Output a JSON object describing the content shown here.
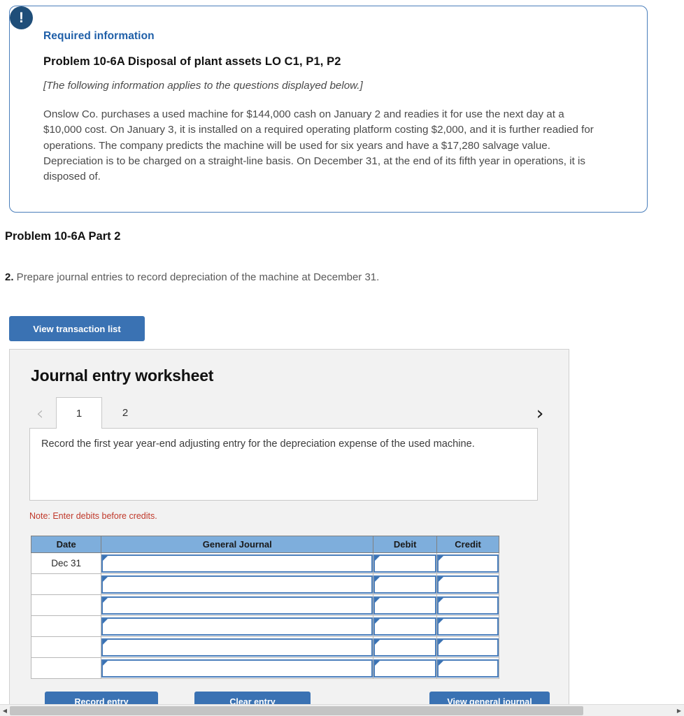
{
  "info_box": {
    "badge_icon": "exclamation-icon",
    "badge_glyph": "!",
    "required_label": "Required information",
    "problem_title": "Problem 10-6A Disposal of plant assets LO C1, P1, P2",
    "applies_note": "[The following information applies to the questions displayed below.]",
    "body": "Onslow Co. purchases a used machine for $144,000 cash on January 2 and readies it for use the next day at a $10,000 cost. On January 3, it is installed on a required operating platform costing $2,000, and it is further readied for operations. The company predicts the machine will be used for six years and have a $17,280 salvage value. Depreciation is to be charged on a straight-line basis. On December 31, at the end of its fifth year in operations, it is disposed of.",
    "border_color": "#4a7ebb",
    "badge_color": "#1f4e79",
    "label_color": "#1f5fa8"
  },
  "part": {
    "heading": "Problem 10-6A Part 2",
    "question_number": "2.",
    "question_text": " Prepare journal entries to record depreciation of the machine at December 31."
  },
  "toolbar": {
    "view_transaction_list": "View transaction list"
  },
  "worksheet": {
    "title": "Journal entry worksheet",
    "prev_icon": "chevron-left-icon",
    "prev_glyph": "‹",
    "next_icon": "chevron-right-icon",
    "next_glyph": "›",
    "tabs": [
      {
        "label": "1",
        "active": true
      },
      {
        "label": "2",
        "active": false
      }
    ],
    "instruction": "Record the first year year-end adjusting entry for the depreciation expense of the used machine.",
    "note": "Note: Enter debits before credits.",
    "note_color": "#c0392b",
    "accent_color": "#3a72b3",
    "header_color": "#7eaedc"
  },
  "table": {
    "columns": [
      "Date",
      "General Journal",
      "Debit",
      "Credit"
    ],
    "rows": [
      {
        "date": "Dec 31",
        "general_journal": "",
        "debit": "",
        "credit": ""
      },
      {
        "date": "",
        "general_journal": "",
        "debit": "",
        "credit": ""
      },
      {
        "date": "",
        "general_journal": "",
        "debit": "",
        "credit": ""
      },
      {
        "date": "",
        "general_journal": "",
        "debit": "",
        "credit": ""
      },
      {
        "date": "",
        "general_journal": "",
        "debit": "",
        "credit": ""
      },
      {
        "date": "",
        "general_journal": "",
        "debit": "",
        "credit": ""
      }
    ]
  },
  "actions": {
    "record_entry": "Record entry",
    "clear_entry": "Clear entry",
    "view_general_journal": "View general journal"
  },
  "scrollbar": {
    "left_glyph": "◀",
    "right_glyph": "▶"
  }
}
